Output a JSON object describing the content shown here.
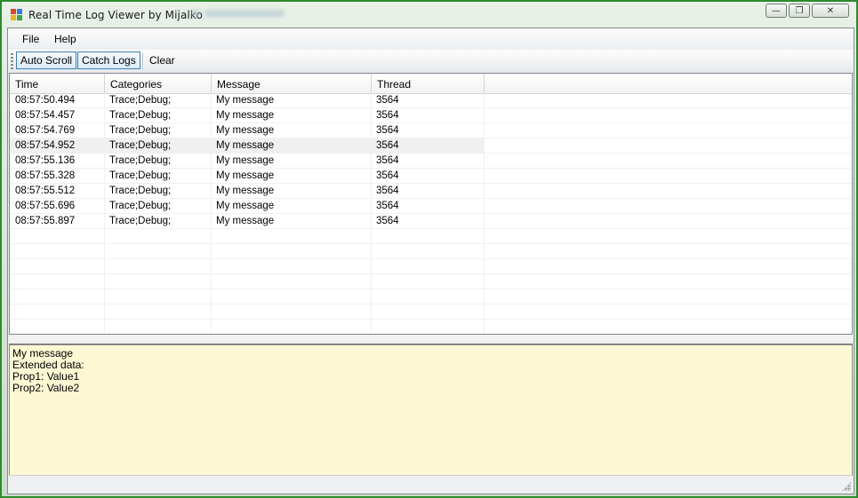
{
  "window": {
    "title": "Real Time Log Viewer by Mijalko",
    "caption": {
      "minimize": "—",
      "maximize": "❐",
      "close": "✕"
    }
  },
  "menu": [
    "File",
    "Help"
  ],
  "toolbar": {
    "auto_scroll": "Auto Scroll",
    "catch_logs": "Catch Logs",
    "clear": "Clear"
  },
  "list": {
    "columns": [
      "Time",
      "Categories",
      "Message",
      "Thread"
    ],
    "rows": [
      [
        "08:57:50.494",
        "Trace;Debug;",
        "My message",
        "3564"
      ],
      [
        "08:57:54.457",
        "Trace;Debug;",
        "My message",
        "3564"
      ],
      [
        "08:57:54.769",
        "Trace;Debug;",
        "My message",
        "3564"
      ],
      [
        "08:57:54.952",
        "Trace;Debug;",
        "My message",
        "3564"
      ],
      [
        "08:57:55.136",
        "Trace;Debug;",
        "My message",
        "3564"
      ],
      [
        "08:57:55.328",
        "Trace;Debug;",
        "My message",
        "3564"
      ],
      [
        "08:57:55.512",
        "Trace;Debug;",
        "My message",
        "3564"
      ],
      [
        "08:57:55.696",
        "Trace;Debug;",
        "My message",
        "3564"
      ],
      [
        "08:57:55.897",
        "Trace;Debug;",
        "My message",
        "3564"
      ]
    ]
  },
  "details": {
    "lines": [
      "My message",
      "Extended data:",
      "Prop1: Value1",
      "Prop2: Value2"
    ]
  },
  "colors": {
    "details_background": "#fdf8d4",
    "window_border": "#2d8a2d"
  },
  "icons": {
    "app": "app-window-icon",
    "resize": "size-grip-icon"
  }
}
